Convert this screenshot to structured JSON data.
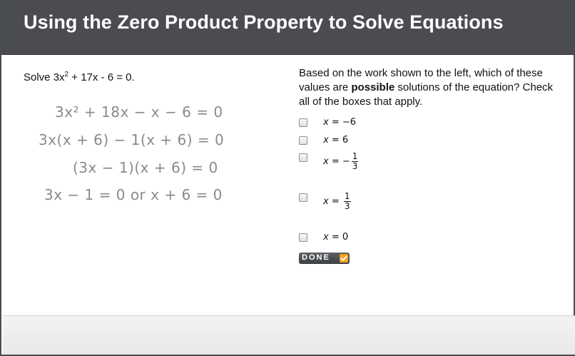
{
  "header": {
    "title": "Using the Zero Product Property to Solve Equations"
  },
  "problem": {
    "prefix": "Solve 3",
    "var1": "x",
    "exp": "2",
    "middle": " + 17",
    "var2": "x",
    "suffix": " - 6 = 0."
  },
  "work": [
    "3x² + 18x − x − 6 = 0",
    "3x(x + 6) − 1(x + 6) = 0",
    "(3x − 1)(x + 6) = 0",
    "3x − 1 = 0 or x + 6 = 0"
  ],
  "question": {
    "part1": "Based on the work shown to the left, which of these values are ",
    "bold": "possible",
    "part2": " solutions of the equation? Check all of the boxes that apply."
  },
  "options": [
    {
      "var": "x",
      "eq": " = ",
      "value": "−6"
    },
    {
      "var": "x",
      "eq": " = ",
      "value": "6"
    },
    {
      "var": "x",
      "eq": " = ",
      "value": "−",
      "num": "1",
      "den": "3"
    },
    {
      "var": "x",
      "eq": " = ",
      "value": "",
      "num": "1",
      "den": "3"
    },
    {
      "var": "x",
      "eq": " = ",
      "value": "0"
    }
  ],
  "done_button": {
    "label": "DONE",
    "icon": "check-icon",
    "check_color": "#f5a21c"
  },
  "colors": {
    "header_bg": "#4a4c52",
    "work_text": "#8a8a8a"
  }
}
